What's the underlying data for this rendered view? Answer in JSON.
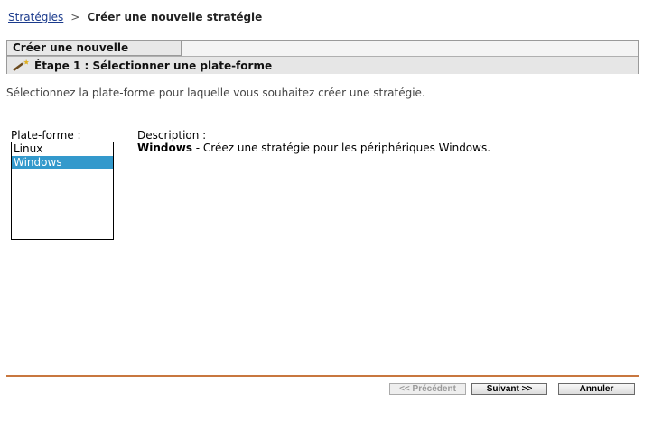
{
  "breadcrumb": {
    "parent": "Stratégies",
    "separator": ">",
    "current": "Créer une nouvelle stratégie"
  },
  "wizard": {
    "tab_label": "Créer une nouvelle stratégie",
    "step_label": "Étape 1 : Sélectionner une plate-forme",
    "step_icon": "wand-icon"
  },
  "instructions": "Sélectionnez la plate-forme pour laquelle vous souhaitez créer une stratégie.",
  "platform": {
    "label": "Plate-forme :",
    "options": [
      {
        "label": "Linux",
        "selected": false
      },
      {
        "label": "Windows",
        "selected": true
      }
    ]
  },
  "description": {
    "label": "Description :",
    "title": "Windows",
    "text": " - Créez une stratégie pour les périphériques Windows."
  },
  "buttons": {
    "previous": "<< Précédent",
    "next": "Suivant >>",
    "cancel": "Annuler"
  },
  "colors": {
    "selection": "#3399cc",
    "footer_rule": "#c8773f",
    "link": "#1a3a8c"
  }
}
